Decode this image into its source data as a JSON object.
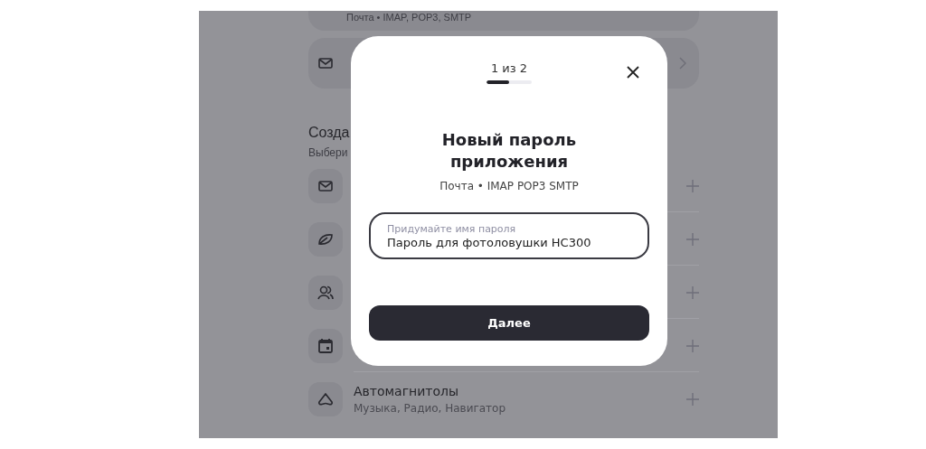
{
  "background": {
    "top_card": {
      "subtitle": "Почта • IMAP, POP3, SMTP"
    },
    "section": {
      "title": "Созда",
      "subtitle": "Выбери"
    },
    "rows": [
      {
        "kind": "mail"
      },
      {
        "kind": "leaf"
      },
      {
        "kind": "people"
      },
      {
        "kind": "calendar"
      },
      {
        "kind": "car",
        "title": "Автомагнитолы",
        "subtitle": "Музыка, Радио, Навигатор"
      }
    ]
  },
  "dialog": {
    "step": "1 из 2",
    "progress": {
      "level": 0.5
    },
    "title": "Новый пароль приложения",
    "subtitle": "Почта • IMAP POP3 SMTP",
    "field": {
      "placeholder": "Придумайте имя пароля",
      "value": "Пароль для фотоловушки HC300"
    },
    "button": "Далее"
  }
}
